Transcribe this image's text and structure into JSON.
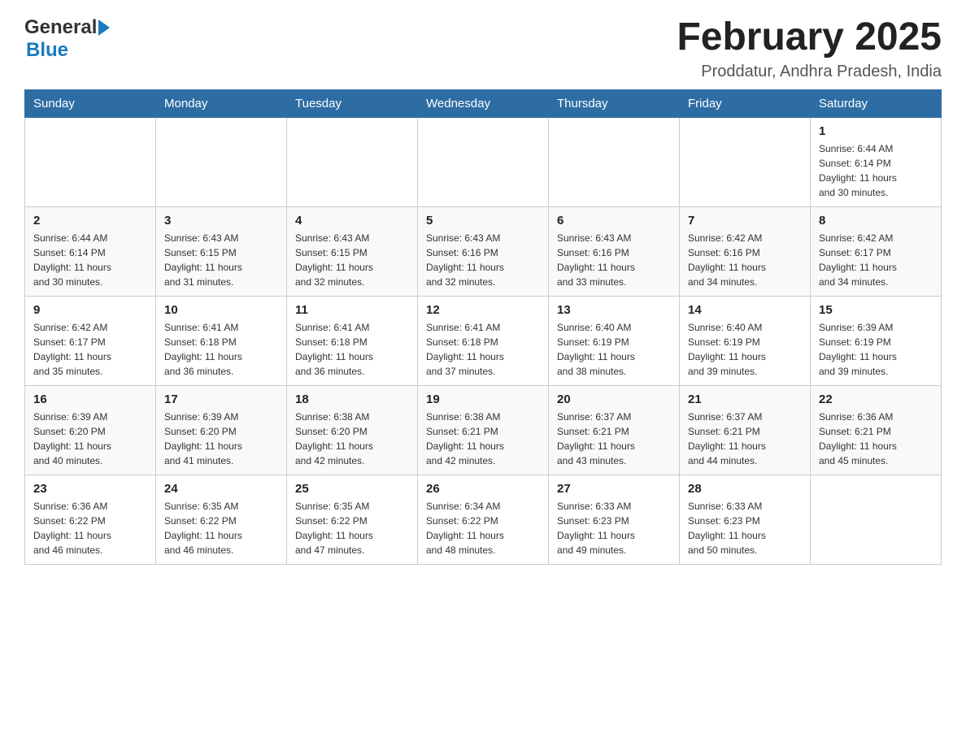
{
  "header": {
    "logo_general": "General",
    "logo_blue": "Blue",
    "month_title": "February 2025",
    "subtitle": "Proddatur, Andhra Pradesh, India"
  },
  "days_of_week": [
    "Sunday",
    "Monday",
    "Tuesday",
    "Wednesday",
    "Thursday",
    "Friday",
    "Saturday"
  ],
  "weeks": [
    [
      {
        "day": "",
        "info": ""
      },
      {
        "day": "",
        "info": ""
      },
      {
        "day": "",
        "info": ""
      },
      {
        "day": "",
        "info": ""
      },
      {
        "day": "",
        "info": ""
      },
      {
        "day": "",
        "info": ""
      },
      {
        "day": "1",
        "info": "Sunrise: 6:44 AM\nSunset: 6:14 PM\nDaylight: 11 hours\nand 30 minutes."
      }
    ],
    [
      {
        "day": "2",
        "info": "Sunrise: 6:44 AM\nSunset: 6:14 PM\nDaylight: 11 hours\nand 30 minutes."
      },
      {
        "day": "3",
        "info": "Sunrise: 6:43 AM\nSunset: 6:15 PM\nDaylight: 11 hours\nand 31 minutes."
      },
      {
        "day": "4",
        "info": "Sunrise: 6:43 AM\nSunset: 6:15 PM\nDaylight: 11 hours\nand 32 minutes."
      },
      {
        "day": "5",
        "info": "Sunrise: 6:43 AM\nSunset: 6:16 PM\nDaylight: 11 hours\nand 32 minutes."
      },
      {
        "day": "6",
        "info": "Sunrise: 6:43 AM\nSunset: 6:16 PM\nDaylight: 11 hours\nand 33 minutes."
      },
      {
        "day": "7",
        "info": "Sunrise: 6:42 AM\nSunset: 6:16 PM\nDaylight: 11 hours\nand 34 minutes."
      },
      {
        "day": "8",
        "info": "Sunrise: 6:42 AM\nSunset: 6:17 PM\nDaylight: 11 hours\nand 34 minutes."
      }
    ],
    [
      {
        "day": "9",
        "info": "Sunrise: 6:42 AM\nSunset: 6:17 PM\nDaylight: 11 hours\nand 35 minutes."
      },
      {
        "day": "10",
        "info": "Sunrise: 6:41 AM\nSunset: 6:18 PM\nDaylight: 11 hours\nand 36 minutes."
      },
      {
        "day": "11",
        "info": "Sunrise: 6:41 AM\nSunset: 6:18 PM\nDaylight: 11 hours\nand 36 minutes."
      },
      {
        "day": "12",
        "info": "Sunrise: 6:41 AM\nSunset: 6:18 PM\nDaylight: 11 hours\nand 37 minutes."
      },
      {
        "day": "13",
        "info": "Sunrise: 6:40 AM\nSunset: 6:19 PM\nDaylight: 11 hours\nand 38 minutes."
      },
      {
        "day": "14",
        "info": "Sunrise: 6:40 AM\nSunset: 6:19 PM\nDaylight: 11 hours\nand 39 minutes."
      },
      {
        "day": "15",
        "info": "Sunrise: 6:39 AM\nSunset: 6:19 PM\nDaylight: 11 hours\nand 39 minutes."
      }
    ],
    [
      {
        "day": "16",
        "info": "Sunrise: 6:39 AM\nSunset: 6:20 PM\nDaylight: 11 hours\nand 40 minutes."
      },
      {
        "day": "17",
        "info": "Sunrise: 6:39 AM\nSunset: 6:20 PM\nDaylight: 11 hours\nand 41 minutes."
      },
      {
        "day": "18",
        "info": "Sunrise: 6:38 AM\nSunset: 6:20 PM\nDaylight: 11 hours\nand 42 minutes."
      },
      {
        "day": "19",
        "info": "Sunrise: 6:38 AM\nSunset: 6:21 PM\nDaylight: 11 hours\nand 42 minutes."
      },
      {
        "day": "20",
        "info": "Sunrise: 6:37 AM\nSunset: 6:21 PM\nDaylight: 11 hours\nand 43 minutes."
      },
      {
        "day": "21",
        "info": "Sunrise: 6:37 AM\nSunset: 6:21 PM\nDaylight: 11 hours\nand 44 minutes."
      },
      {
        "day": "22",
        "info": "Sunrise: 6:36 AM\nSunset: 6:21 PM\nDaylight: 11 hours\nand 45 minutes."
      }
    ],
    [
      {
        "day": "23",
        "info": "Sunrise: 6:36 AM\nSunset: 6:22 PM\nDaylight: 11 hours\nand 46 minutes."
      },
      {
        "day": "24",
        "info": "Sunrise: 6:35 AM\nSunset: 6:22 PM\nDaylight: 11 hours\nand 46 minutes."
      },
      {
        "day": "25",
        "info": "Sunrise: 6:35 AM\nSunset: 6:22 PM\nDaylight: 11 hours\nand 47 minutes."
      },
      {
        "day": "26",
        "info": "Sunrise: 6:34 AM\nSunset: 6:22 PM\nDaylight: 11 hours\nand 48 minutes."
      },
      {
        "day": "27",
        "info": "Sunrise: 6:33 AM\nSunset: 6:23 PM\nDaylight: 11 hours\nand 49 minutes."
      },
      {
        "day": "28",
        "info": "Sunrise: 6:33 AM\nSunset: 6:23 PM\nDaylight: 11 hours\nand 50 minutes."
      },
      {
        "day": "",
        "info": ""
      }
    ]
  ]
}
